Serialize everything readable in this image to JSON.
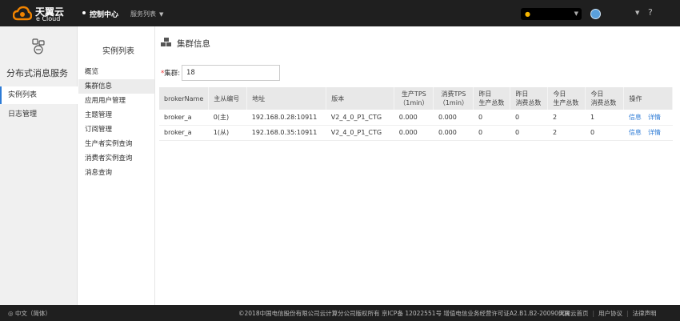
{
  "brand": {
    "name_cn": "天翼云",
    "name_en": "e Cloud"
  },
  "topnav": {
    "console": "控制中心",
    "services": "服务列表"
  },
  "sidebar": {
    "title": "分布式消息服务",
    "items": [
      {
        "label": "实例列表",
        "active": true
      },
      {
        "label": "日志管理",
        "active": false
      }
    ]
  },
  "subnav": {
    "title": "实例列表",
    "items": [
      {
        "label": "概览"
      },
      {
        "label": "集群信息",
        "active": true
      },
      {
        "label": "应用用户管理"
      },
      {
        "label": "主题管理"
      },
      {
        "label": "订阅管理"
      },
      {
        "label": "生产者实例查询"
      },
      {
        "label": "消费者实例查询"
      },
      {
        "label": "消息查询"
      }
    ]
  },
  "page": {
    "title": "集群信息",
    "cluster_label": "集群:",
    "cluster_value": "18"
  },
  "table": {
    "headers": [
      [
        "brokerName"
      ],
      [
        "主从编号"
      ],
      [
        "地址"
      ],
      [
        "版本"
      ],
      [
        "生产TPS",
        "（1min）"
      ],
      [
        "消费TPS",
        "（1min）"
      ],
      [
        "昨日",
        "生产总数"
      ],
      [
        "昨日",
        "消费总数"
      ],
      [
        "今日",
        "生产总数"
      ],
      [
        "今日",
        "消费总数"
      ],
      [
        "操作"
      ]
    ],
    "rows": [
      {
        "broker": "broker_a",
        "role": "0(主)",
        "addr": "192.168.0.28:10911",
        "version": "V2_4_0_P1_CTG",
        "ptps": "0.000",
        "ctps": "0.000",
        "yprod": "0",
        "ycons": "0",
        "tprod": "2",
        "tcons": "1",
        "op1": "信息",
        "op2": "详情"
      },
      {
        "broker": "broker_a",
        "role": "1(从)",
        "addr": "192.168.0.35:10911",
        "version": "V2_4_0_P1_CTG",
        "ptps": "0.000",
        "ctps": "0.000",
        "yprod": "0",
        "ycons": "0",
        "tprod": "2",
        "tcons": "0",
        "op1": "信息",
        "op2": "详情"
      }
    ]
  },
  "footer": {
    "lang": "中文（简体）",
    "copyright": "©2018中国电信股份有限公司云计算分公司版权所有 京ICP备 12022551号 增值电信业务经营许可证A2.B1.B2-20090001",
    "links": [
      "天翼云首页",
      "用户协议",
      "法律声明"
    ]
  },
  "icons": {
    "logo": "ecloud-logo-icon",
    "region": "location-pin-icon",
    "avatar": "user-avatar-icon",
    "help": "help-icon",
    "service": "message-service-icon",
    "cluster": "cubes-icon",
    "globe": "globe-icon"
  },
  "colors": {
    "accent": "#2d7bd6",
    "topbar": "#1f1f1f",
    "required": "#e33333",
    "brand_orange": "#f08300"
  }
}
